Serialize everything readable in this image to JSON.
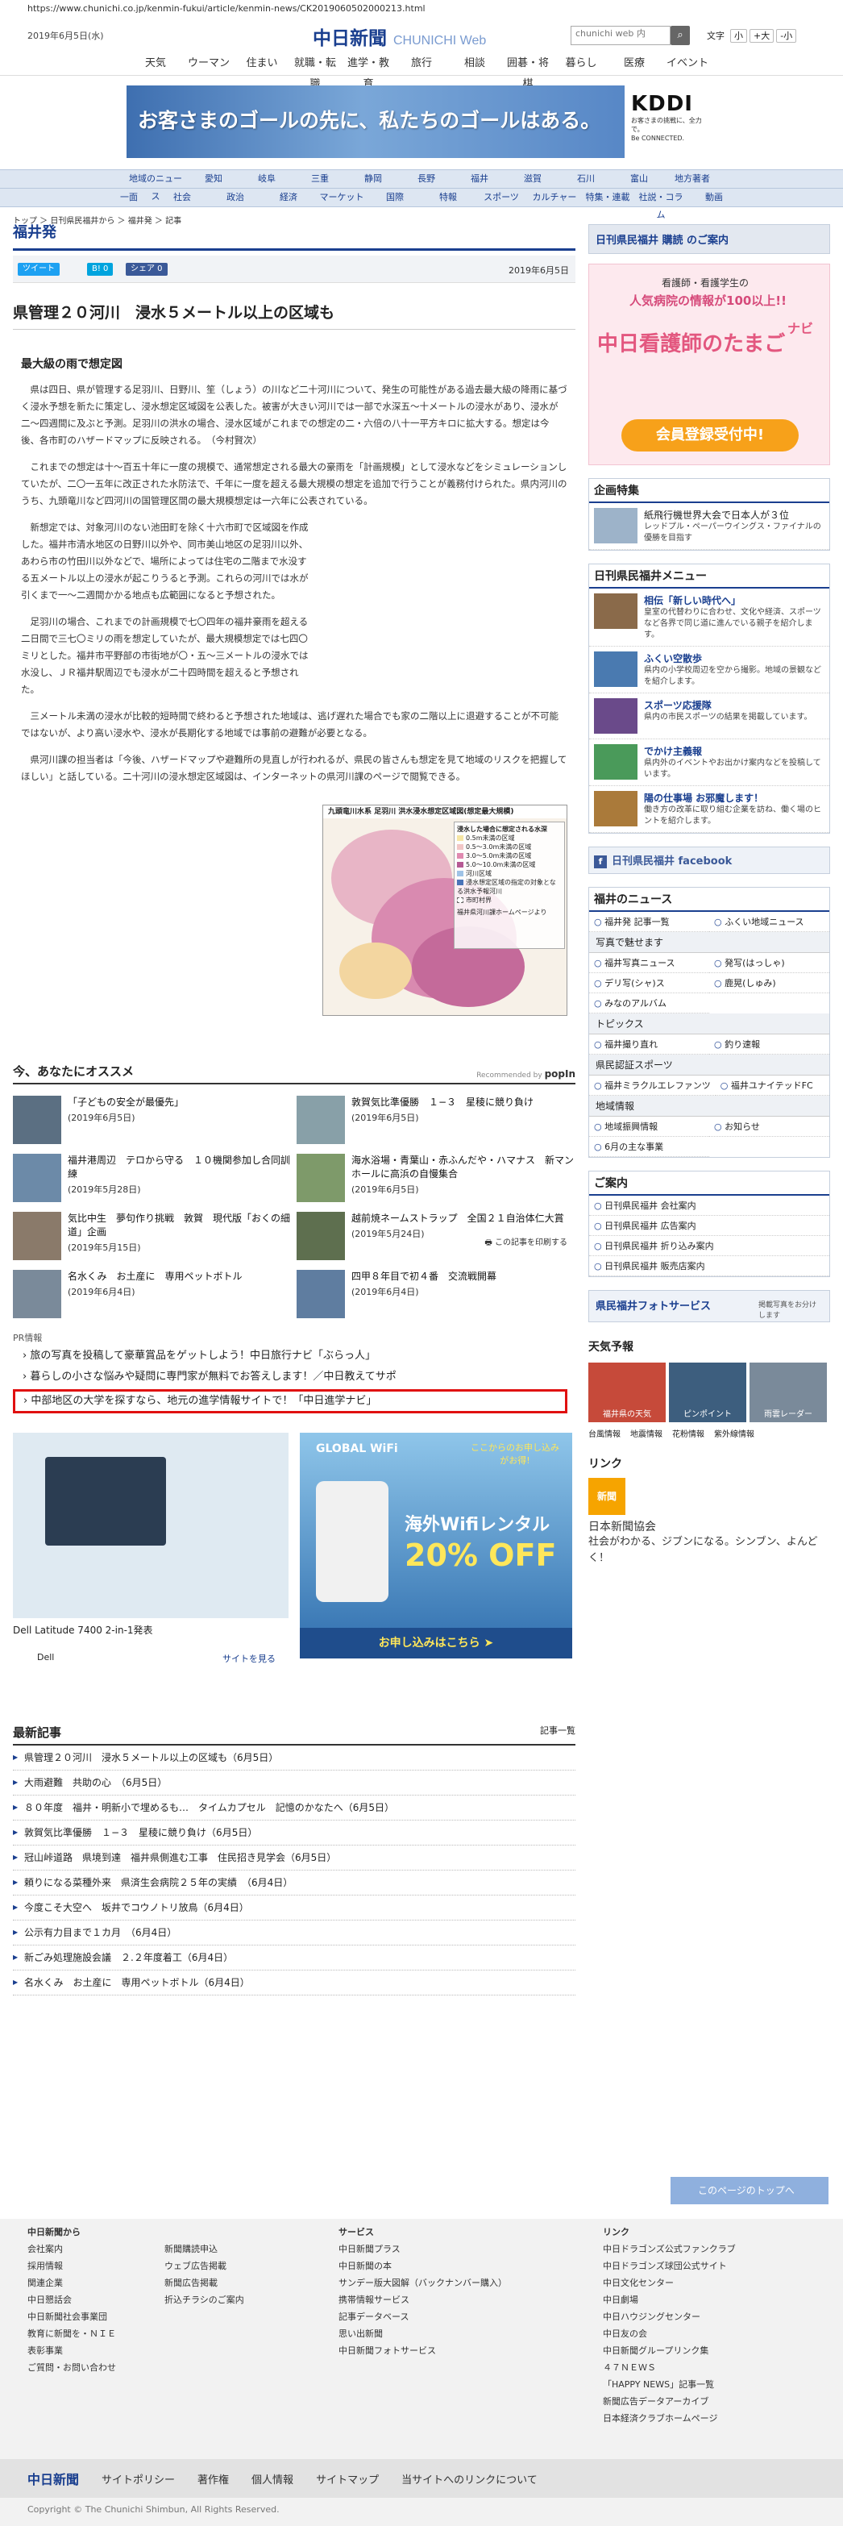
{
  "browser": {
    "url": "https://www.chunichi.co.jp/kenmin-fukui/article/kenmin-news/CK2019060502000213.html"
  },
  "header": {
    "date": "2019年6月5日(水)",
    "logo": "中日新聞",
    "logo_sub": "CHUNICHI Web",
    "search_placeholder": "chunichi web 内",
    "font_label": "文字",
    "font_sizes": [
      "小",
      "+大",
      "-小"
    ],
    "nav": [
      "天気",
      "ウーマン",
      "住まい",
      "就職・転職",
      "進学・教育",
      "旅行",
      "相談",
      "囲碁・将棋",
      "暮らし",
      "医療",
      "イベント"
    ]
  },
  "ad_banner": {
    "text": "お客さまのゴールの先に、私たちのゴールはある。",
    "brand": "KDDI",
    "small": "お客さまの挑戦に、全力で。",
    "tag": "Be CONNECTED."
  },
  "section_nav": {
    "row1": [
      "地域のニュース",
      "愛知",
      "岐阜",
      "三重",
      "静岡",
      "長野",
      "福井",
      "滋賀",
      "石川",
      "富山",
      "地方著者"
    ],
    "row2": [
      "一面",
      "社会",
      "政治",
      "経済",
      "マーケット",
      "国際",
      "特報",
      "スポーツ",
      "カルチャー",
      "特集・連載",
      "社説・コラム",
      "動画"
    ]
  },
  "breadcrumb": "トップ ＞ 日刊県民福井から ＞ 福井発 ＞ 記事",
  "page_title": "福井発",
  "share": {
    "tweet": "ツイート",
    "hatena": "B! 0",
    "facebook": "シェア 0",
    "date": "2019年6月5日"
  },
  "article": {
    "title": "県管理２０河川　浸水５メートル以上の区域も",
    "subhead": "最大級の雨で想定図",
    "paragraphs": [
      "県は四日、県が管理する足羽川、日野川、笙（しょう）の川など二十河川について、発生の可能性がある過去最大級の降雨に基づく浸水予想を新たに策定し、浸水想定区域図を公表した。被害が大きい河川では一部で水深五〜十メートルの浸水があり、浸水が二〜四週間に及ぶと予測。足羽川の洪水の場合、浸水区域がこれまでの想定の二・六倍の八十一平方キロに拡大する。想定は今後、各市町のハザードマップに反映される。　（今村賢次）",
      "これまでの想定は十〜百五十年に一度の規模で、通常想定される最大の豪雨を「計画規模」として浸水などをシミュレーションしていたが、二〇一五年に改正された水防法で、千年に一度を超える最大規模の想定を追加で行うことが義務付けられた。県内河川のうち、九頭竜川など四河川の国管理区間の最大規模想定は一六年に公表されている。",
      "新想定では、対象河川のない池田町を除く十六市町で区域図を作成した。福井市清水地区の日野川以外や、同市美山地区の足羽川以外、あわら市の竹田川以外などで、場所によっては住宅の二階まで水没する五メートル以上の浸水が起こりうると予測。これらの河川では水が引くまで一〜二週間かかる地点も広範囲になると予想された。",
      "足羽川の場合、これまでの計画規模で七〇四年の福井豪雨を超える二日間で三七〇ミリの雨を想定していたが、最大規模想定では七四〇ミリとした。福井市平野部の市街地が〇・五〜三メートルの浸水では水没し、ＪＲ福井駅周辺でも浸水が二十四時間を超えると予想された。",
      "三メートル未満の浸水が比較的短時間で終わると予想された地域は、逃げ遅れた場合でも家の二階以上に退避することが不可能ではないが、より高い浸水や、浸水が長期化する地域では事前の避難が必要となる。",
      "県河川課の担当者は「今後、ハザードマップや避難所の見直しが行われるが、県民の皆さんも想定を見て地域のリスクを把握してほしい」と話している。二十河川の浸水想定区域図は、インターネットの県河川課のページで閲覧できる。"
    ],
    "map_title": "九頭竜川水系 足羽川 洪水浸水想定区域図(想定最大規模)",
    "map_legend_title": "浸水した場合に想定される水深",
    "map_legend": [
      "0.5m未満の区域",
      "0.5〜3.0m未満の区域",
      "3.0〜5.0m未満の区域",
      "5.0〜10.0m未満の区域"
    ],
    "map_legend_extra": [
      "河川区域",
      "浸水想定区域の指定の対象となる洪水予報河川",
      "市町村界",
      "福井県河川課ホームページより"
    ],
    "print": "この記事を印刷する"
  },
  "osusume": {
    "title": "今、あなたにオススメ",
    "rec_label": "Recommended by",
    "rec_brand": "popIn",
    "items": [
      {
        "title": "「子どもの安全が最優先」",
        "date": "(2019年6月5日)",
        "color": "#5b6f82"
      },
      {
        "title": "敦賀気比準優勝　１−３　星稜に競り負け",
        "date": "(2019年6月5日)",
        "color": "#88a0a8"
      },
      {
        "title": "福井港周辺　テロから守る　１０機関参加し合同訓練",
        "date": "(2019年5月28日)",
        "color": "#6c8aa8"
      },
      {
        "title": "海水浴場・青葉山・赤ふんだや・ハマナス　新マンホールに高浜の自慢集合",
        "date": "(2019年6月5日)",
        "color": "#7e9a6a"
      },
      {
        "title": "気比中生　夢句作り挑戦　敦賀　現代版「おくの細道」企画",
        "date": "(2019年5月15日)",
        "color": "#8a7a6a"
      },
      {
        "title": "越前焼ネームストラップ　全国２１自治体仁大賞",
        "date": "(2019年5月24日)",
        "color": "#5e6f4f"
      },
      {
        "title": "名水くみ　お土産に　専用ペットボトル",
        "date": "(2019年6月4日)",
        "color": "#7a8a9a"
      },
      {
        "title": "四甲８年目で初４番　交流戦開幕",
        "date": "(2019年6月4日)",
        "color": "#5f7da0"
      }
    ],
    "pr_label": "PR情報",
    "pr": [
      "旅の写真を投稿して豪華賞品をゲットしよう！中日旅行ナビ「ぶらっ人」",
      "暮らしの小さな悩みや疑問に専門家が無料でお答えします！／中日教えてサポ",
      "中部地区の大学を探すなら、地元の進学情報サイトで！「中日進学ナビ」"
    ]
  },
  "ads": {
    "dell_title": "Dell Latitude 7400 2-in-1発表",
    "dell_brand": "Dell",
    "dell_cta": "サイトを見る",
    "wifi_brand": "GLOBAL WiFi",
    "wifi_top": "ここからのお申し込みがお得!",
    "wifi_headline": "海外Wifiレンタル",
    "wifi_off": "20% OFF",
    "wifi_cta": "お申し込みはこちら ➤"
  },
  "latest": {
    "title": "最新記事",
    "more": "記事一覧",
    "items": [
      "県管理２０河川　浸水５メートル以上の区域も（6月5日）",
      "大雨避難　共助の心　（6月5日）",
      "８０年度　福井・明新小で埋めるも…　タイムカプセル　記憶のかなたへ（6月5日）",
      "敦賀気比準優勝　１−３　星稜に競り負け（6月5日）",
      "冠山峠道路　県境到達　福井県側進む工事　住民招き見学会（6月5日）",
      "頼りになる菜種外来　県済生会病院２５年の実績　（6月4日）",
      "今度こそ大空へ　坂井でコウノトリ放鳥（6月4日）",
      "公示有力目まで１カ月　（6月4日）",
      "新ごみ処理施設会議　２.２年度着工（6月4日）",
      "名水くみ　お土産に　専用ペットボトル（6月4日）"
    ]
  },
  "sidebar": {
    "subscribe": "日刊県民福井 購読 のご案内",
    "nurse_ad": [
      "看護師・看護学生の",
      "人気病院の情報が100以上!!",
      "中日看護師のたまご",
      "ナビ",
      "会員登録受付中!"
    ],
    "kikaku_title": "企画特集",
    "kikaku_item": {
      "title": "紙飛行機世界大会で日本人が３位",
      "desc": "レッドプル・ペーパーウイングス・ファイナルの優勝を目指す"
    },
    "menu_title": "日刊県民福井メニュー",
    "menu": [
      {
        "title": "相伝「新しい時代へ」",
        "desc": "皇室の代替わりに合わせ、文化や経済、スポーツなど各界で同じ道に進んでいる親子を紹介します。"
      },
      {
        "title": "ふくい空散歩",
        "desc": "県内の小学校周辺を空から撮影。地域の景観などを紹介します。"
      },
      {
        "title": "スポーツ応援隊",
        "desc": "県内の市民スポーツの結果を掲載しています。"
      },
      {
        "title": "でかけ主義報",
        "desc": "県内外のイベントやお出かけ案内などを投稿しています。"
      },
      {
        "title": "陽の仕事場 お邪魔します！",
        "desc": "働き方の改革に取り組む企業を訪ね、働く場のヒントを紹介します。"
      }
    ],
    "facebook": "日刊県民福井 facebook",
    "news_title": "福井のニュース",
    "news_links": [
      "福井発 記事一覧",
      "ふくい地域ニュース"
    ],
    "photo_title": "写真で魅せます",
    "photo_links": [
      "福井写真ニュース",
      "発写(はっしゃ)",
      "デリ写(シャ)ス",
      "鹿晃(しゅみ)",
      "みなのアルバム"
    ],
    "topic_title": "トピックス",
    "topic_links": [
      "福井撮り直れ",
      "釣り速報"
    ],
    "sports_title": "県民認証スポーツ",
    "sports_links": [
      "福井ミラクルエレファンツ",
      "福井ユナイテッドFC"
    ],
    "region_title": "地域情報",
    "region_links": [
      "地域振興情報",
      "お知らせ",
      "6月の主な事業"
    ],
    "guide_title": "ご案内",
    "guide_links": [
      "日刊県民福井 会社案内",
      "日刊県民福井 広告案内",
      "日刊県民福井 折り込み案内",
      "日刊県民福井 販売店案内"
    ],
    "photo_service": "県民福井フォトサービス",
    "photo_service_sub": "掲載写真をお分けします",
    "weather_title": "天気予報",
    "weather": [
      "福井県の天気",
      "ピンポイント",
      "雨雲レーダー"
    ],
    "weather_links": [
      "台風情報",
      "地震情報",
      "花粉情報",
      "紫外線情報"
    ],
    "link_title": "リンク",
    "link_name": "日本新聞協会",
    "link_logo": "新聞",
    "link_desc": "社会がわかる、ジブンになる。シンブン、よんどく！"
  },
  "footer": {
    "to_top": "このページのトップへ",
    "col1_title": "中日新聞から",
    "col1": [
      "会社案内",
      "採用情報",
      "関連企業",
      "中日懇話会",
      "中日新聞社会事業団",
      "教育に新聞を・ＮＩＥ",
      "表彰事業",
      "ご質問・お問い合わせ"
    ],
    "col2": [
      "新聞購読申込",
      "ウェブ広告掲載",
      "新聞広告掲載",
      "折込チラシのご案内"
    ],
    "col3_title": "サービス",
    "col3": [
      "中日新聞プラス",
      "中日新聞の本",
      "サンデー版大図解（バックナンバー購入）",
      "携帯情報サービス",
      "記事データベース",
      "思い出新聞",
      "中日新聞フォトサービス"
    ],
    "col4_title": "リンク",
    "col4": [
      "中日ドラゴンズ公式ファンクラブ",
      "中日ドラゴンズ球団公式サイト",
      "中日文化センター",
      "中日劇場",
      "中日ハウジングセンター",
      "中日友の会",
      "中日新聞グループリンク集",
      "４７ＮＥＷＳ",
      "「HAPPY NEWS」記事一覧",
      "新聞広告データアーカイブ",
      "日本経済クラブホームページ"
    ],
    "bar": [
      "中日新聞",
      "サイトポリシー",
      "著作権",
      "個人情報",
      "サイトマップ",
      "当サイトへのリンクについて"
    ],
    "copyright": "Copyright © The Chunichi Shimbun, All Rights Reserved."
  }
}
